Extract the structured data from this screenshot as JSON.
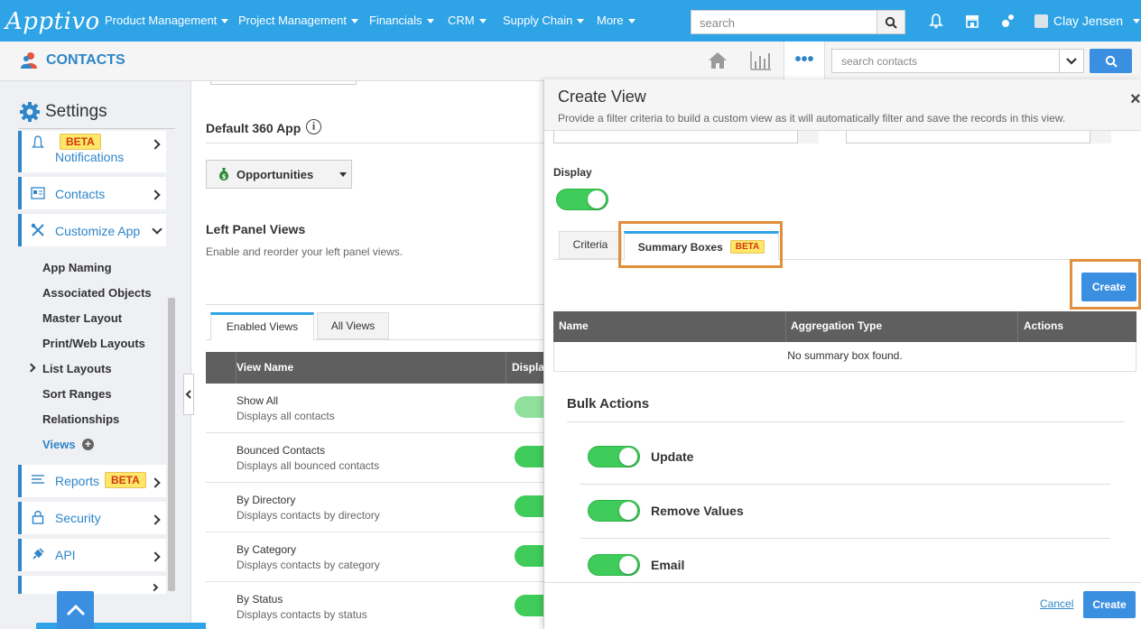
{
  "app": {
    "logo": "Apptivo",
    "user": "Clay Jensen"
  },
  "topnav": {
    "items": [
      "Product Management",
      "Project Management",
      "Financials",
      "CRM",
      "Supply Chain",
      "More"
    ],
    "search_placeholder": "search"
  },
  "subheader": {
    "title": "CONTACTS",
    "search_placeholder": "search contacts"
  },
  "sidebar": {
    "title": "Settings",
    "items": [
      {
        "label": "Notifications",
        "badge": "BETA"
      },
      {
        "label": "Contacts"
      },
      {
        "label": "Customize App"
      },
      {
        "label": "Reports",
        "badge": "BETA"
      },
      {
        "label": "Security"
      },
      {
        "label": "API"
      }
    ],
    "subitems": [
      "App Naming",
      "Associated Objects",
      "Master Layout",
      "Print/Web Layouts",
      "List Layouts",
      "Sort Ranges",
      "Relationships",
      "Views"
    ]
  },
  "main": {
    "default_app_label": "Default 360 App",
    "default_app_value": "Opportunities",
    "left_panel_title": "Left Panel Views",
    "left_panel_desc": "Enable and reorder your left panel views.",
    "tabs": [
      "Enabled Views",
      "All Views"
    ],
    "table_headers": [
      "View Name",
      "Displa"
    ],
    "rows": [
      {
        "title": "Show All",
        "desc": "Displays all contacts"
      },
      {
        "title": "Bounced Contacts",
        "desc": "Displays all bounced contacts"
      },
      {
        "title": "By Directory",
        "desc": "Displays contacts by directory"
      },
      {
        "title": "By Category",
        "desc": "Displays contacts by category"
      },
      {
        "title": "By Status",
        "desc": "Displays contacts by status"
      }
    ]
  },
  "panel": {
    "title": "Create View",
    "description": "Provide a filter criteria to build a custom view as it will automatically filter and save the records in this view.",
    "display_label": "Display",
    "tabs": {
      "criteria": "Criteria",
      "summary": "Summary Boxes",
      "summary_badge": "BETA"
    },
    "create_label": "Create",
    "summary_headers": [
      "Name",
      "Aggregation Type",
      "Actions"
    ],
    "summary_empty": "No summary box found.",
    "bulk_title": "Bulk Actions",
    "bulk_items": [
      "Update",
      "Remove Values",
      "Email"
    ],
    "cancel_label": "Cancel",
    "footer_create_label": "Create"
  },
  "colors": {
    "nav": "#2ea3e6",
    "accent": "#2e86c9",
    "toggle": "#3fcc5a",
    "highlight": "#e18f3a"
  }
}
